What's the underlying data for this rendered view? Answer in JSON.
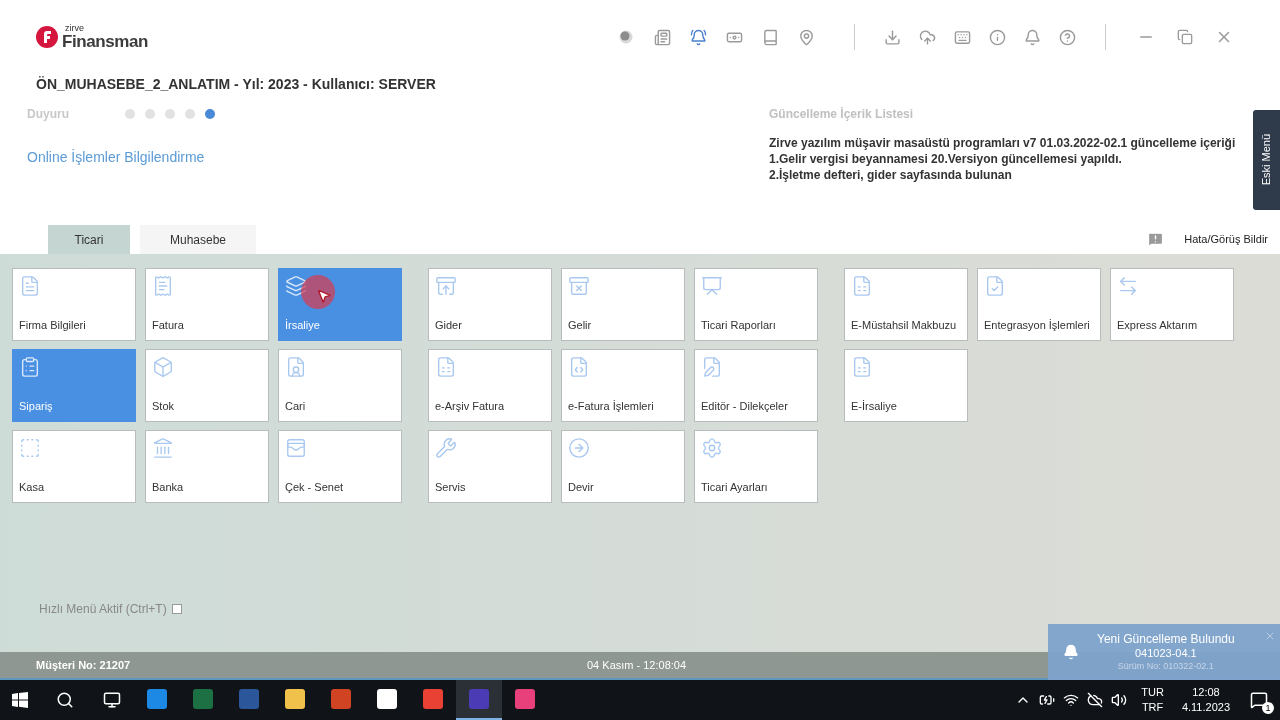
{
  "header": {
    "logo_small": "zirve",
    "logo": "Finansman",
    "title": "ÖN_MUHASEBE_2_ANLATIM - Yıl: 2023 - Kullanıcı: SERVER"
  },
  "announcement": {
    "label": "Duyuru",
    "dots": [
      {
        "selected": false
      },
      {
        "selected": false
      },
      {
        "selected": false
      },
      {
        "selected": false
      },
      {
        "selected": true
      }
    ],
    "link": "Online İşlemler Bilgilendirme"
  },
  "update_list": {
    "title": "Güncelleme İçerik Listesi",
    "lines": [
      "Zirve yazılım müşavir masaüstü programları v7 01.03.2022-02.1 güncelleme içeriği",
      "1.Gelir vergisi beyannamesi 20.Versiyon güncellemesi yapıldı.",
      "2.İşletme defteri, gider sayfasında bulunan"
    ]
  },
  "side_tab": "Eski Menü",
  "tabs": [
    {
      "label": "Ticari",
      "selected": true
    },
    {
      "label": "Muhasebe",
      "selected": false
    }
  ],
  "feedback": "Hata/Görüş Bildir",
  "tile_groups": [
    [
      {
        "label": "Firma Bilgileri",
        "selected": false
      },
      {
        "label": "Fatura",
        "selected": false
      },
      {
        "label": "İrsaliye",
        "selected": true
      },
      {
        "label": "Sipariş",
        "selected": true
      },
      {
        "label": "Stok",
        "selected": false
      },
      {
        "label": "Cari",
        "selected": false
      },
      {
        "label": "Kasa",
        "selected": false
      },
      {
        "label": "Banka",
        "selected": false
      },
      {
        "label": "Çek - Senet",
        "selected": false
      }
    ],
    [
      {
        "label": "Gider",
        "selected": false
      },
      {
        "label": "Gelir",
        "selected": false
      },
      {
        "label": "Ticari Raporları",
        "selected": false
      },
      {
        "label": "e-Arşiv Fatura",
        "selected": false
      },
      {
        "label": "e-Fatura İşlemleri",
        "selected": false
      },
      {
        "label": "Editör - Dilekçeler",
        "selected": false
      },
      {
        "label": "Servis",
        "selected": false
      },
      {
        "label": "Devir",
        "selected": false
      },
      {
        "label": "Ticari Ayarları",
        "selected": false
      }
    ],
    [
      {
        "label": "E-Müstahsil Makbuzu",
        "selected": false
      },
      {
        "label": "Entegrasyon İşlemleri",
        "selected": false
      },
      {
        "label": "Express Aktarım",
        "selected": false
      },
      {
        "label": "E-İrsaliye",
        "selected": false
      }
    ]
  ],
  "quick_menu": {
    "label": "Hızlı Menü Aktif (Ctrl+T)",
    "checked": false
  },
  "status_bar": {
    "customer": "Müşteri No: 21207",
    "datetime": "04 Kasım - 12:08:04"
  },
  "toast": {
    "title": "Yeni Güncelleme Bulundu",
    "version": "041023-04.1",
    "current": "Sürüm No: 010322-02.1"
  },
  "taskbar": {
    "apps": [
      {
        "selected": false
      },
      {
        "selected": false
      },
      {
        "selected": false
      },
      {
        "selected": false
      },
      {
        "selected": false
      },
      {
        "selected": false
      },
      {
        "selected": false
      },
      {
        "selected": true
      },
      {
        "selected": false
      }
    ],
    "language": "TUR",
    "layout": "TRF",
    "time": "12:08",
    "date": "4.11.2023",
    "notifications": "1"
  }
}
